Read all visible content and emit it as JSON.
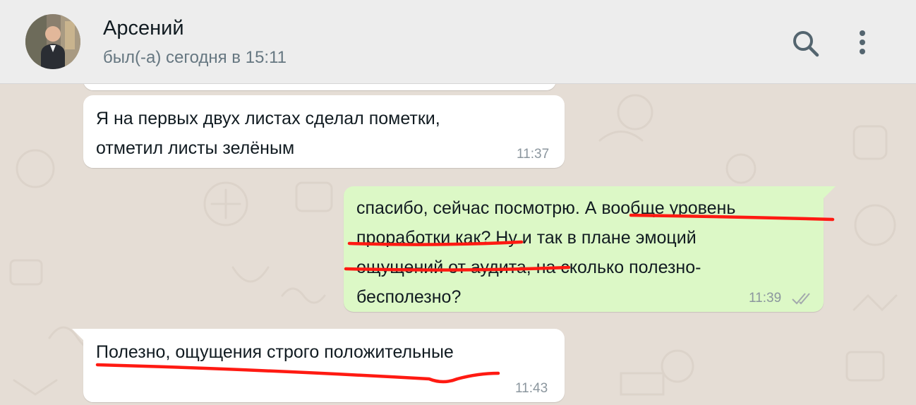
{
  "contact": {
    "name": "Арсений",
    "status": "был(-а) сегодня в 15:11"
  },
  "colors": {
    "header_bg": "#ededed",
    "chat_bg": "#e5ddd5",
    "incoming_bubble": "#ffffff",
    "outgoing_bubble": "#dcf8c6",
    "annotation_red": "#ff1a12",
    "read_ticks": "#a3a9ad"
  },
  "icons": {
    "search": "search-icon",
    "menu": "more-vertical-icon",
    "read_receipt": "double-check-icon"
  },
  "messages": [
    {
      "direction": "incoming",
      "text": "Я на первых двух листах сделал пометки,\nотметил листы зелёным",
      "time": "11:37"
    },
    {
      "direction": "outgoing",
      "text": "спасибо, сейчас посмотрю. А вообще уровень\nпроработки как? Ну и так в плане эмоций\nощущений от аудита, на сколько полезно-\nбесполезно?",
      "time": "11:39",
      "status": "read"
    },
    {
      "direction": "incoming",
      "text": "Полезно, ощущения строго положительные",
      "time": "11:43"
    }
  ]
}
